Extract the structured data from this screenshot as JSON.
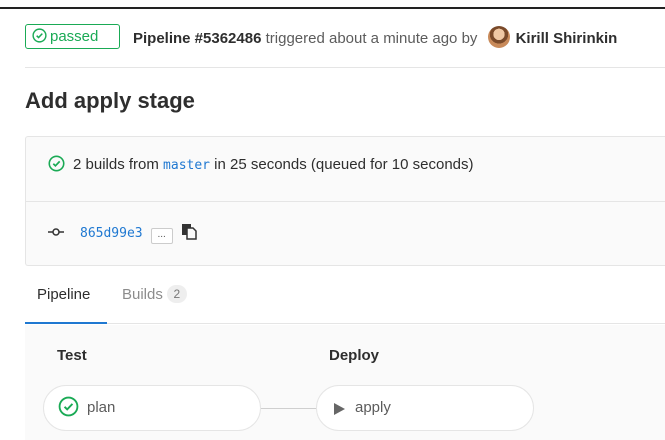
{
  "header": {
    "status_badge": "passed",
    "pipeline_label": "Pipeline #5362486",
    "triggered_text": " triggered about a minute ago by ",
    "author": "Kirill Shirinkin"
  },
  "title": "Add apply stage",
  "info": {
    "builds_prefix": "2 builds from ",
    "branch": "master",
    "builds_suffix": " in 25 seconds (queued for 10 seconds)",
    "commit_sha": "865d99e3",
    "ellipsis": "..."
  },
  "tabs": [
    {
      "label": "Pipeline"
    },
    {
      "label": "Builds",
      "count": "2"
    }
  ],
  "stages": [
    {
      "name": "Test",
      "job": "plan"
    },
    {
      "name": "Deploy",
      "job": "apply"
    }
  ],
  "colors": {
    "success": "#1aaa55",
    "link": "#1f78d1",
    "border": "#e5e5e5"
  }
}
